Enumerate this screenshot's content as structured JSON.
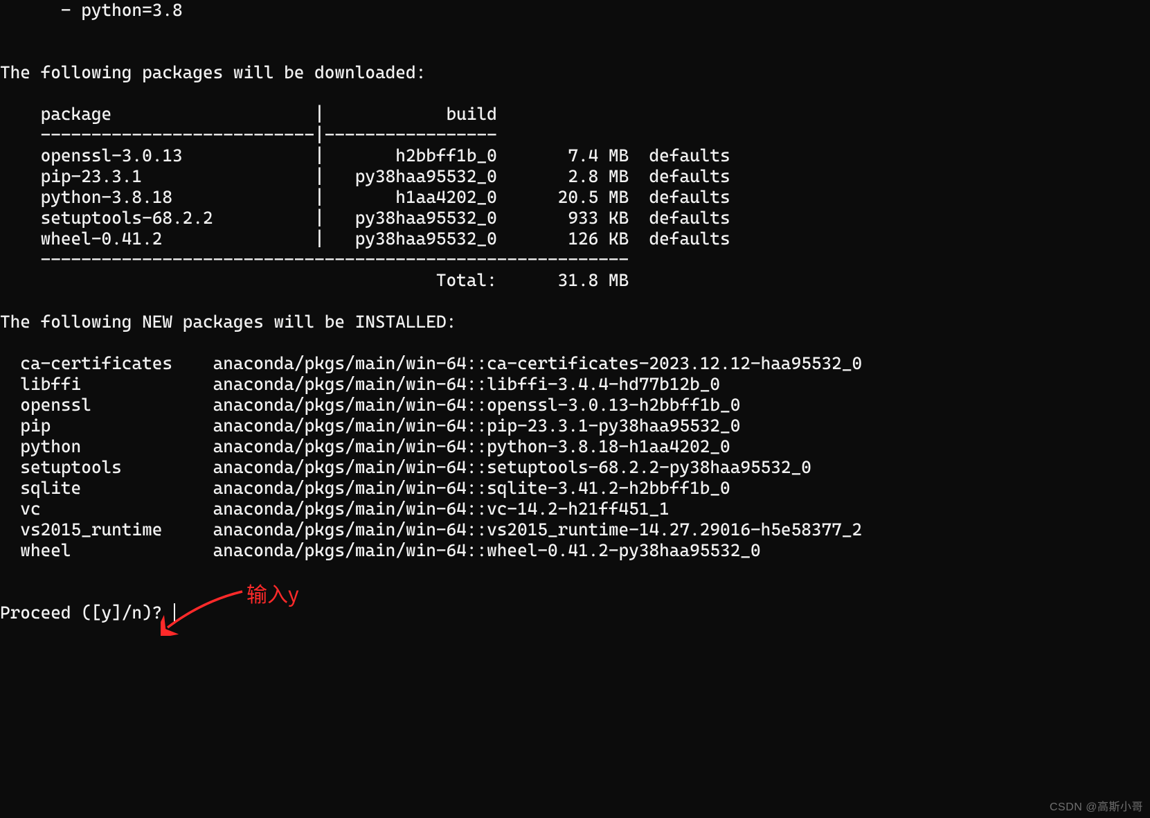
{
  "spec_line": "  - python=3.8",
  "download_heading": "The following packages will be downloaded:",
  "download_table": {
    "header": {
      "package": "package",
      "build": "build"
    },
    "rows": [
      {
        "package": "openssl-3.0.13",
        "build": "h2bbff1b_0",
        "size": "7.4 MB",
        "channel": "defaults"
      },
      {
        "package": "pip-23.3.1",
        "build": "py38haa95532_0",
        "size": "2.8 MB",
        "channel": "defaults"
      },
      {
        "package": "python-3.8.18",
        "build": "h1aa4202_0",
        "size": "20.5 MB",
        "channel": "defaults"
      },
      {
        "package": "setuptools-68.2.2",
        "build": "py38haa95532_0",
        "size": "933 KB",
        "channel": "defaults"
      },
      {
        "package": "wheel-0.41.2",
        "build": "py38haa95532_0",
        "size": "126 KB",
        "channel": "defaults"
      }
    ],
    "total_label": "Total:",
    "total_value": "31.8 MB"
  },
  "install_heading": "The following NEW packages will be INSTALLED:",
  "install_rows": [
    {
      "name": "ca-certificates",
      "spec": "anaconda/pkgs/main/win-64::ca-certificates-2023.12.12-haa95532_0"
    },
    {
      "name": "libffi",
      "spec": "anaconda/pkgs/main/win-64::libffi-3.4.4-hd77b12b_0"
    },
    {
      "name": "openssl",
      "spec": "anaconda/pkgs/main/win-64::openssl-3.0.13-h2bbff1b_0"
    },
    {
      "name": "pip",
      "spec": "anaconda/pkgs/main/win-64::pip-23.3.1-py38haa95532_0"
    },
    {
      "name": "python",
      "spec": "anaconda/pkgs/main/win-64::python-3.8.18-h1aa4202_0"
    },
    {
      "name": "setuptools",
      "spec": "anaconda/pkgs/main/win-64::setuptools-68.2.2-py38haa95532_0"
    },
    {
      "name": "sqlite",
      "spec": "anaconda/pkgs/main/win-64::sqlite-3.41.2-h2bbff1b_0"
    },
    {
      "name": "vc",
      "spec": "anaconda/pkgs/main/win-64::vc-14.2-h21ff451_1"
    },
    {
      "name": "vs2015_runtime",
      "spec": "anaconda/pkgs/main/win-64::vs2015_runtime-14.27.29016-h5e58377_2"
    },
    {
      "name": "wheel",
      "spec": "anaconda/pkgs/main/win-64::wheel-0.41.2-py38haa95532_0"
    }
  ],
  "prompt": "Proceed ([y]/n)? ",
  "annotation_text": "输入y",
  "watermark": "CSDN @高斯小哥"
}
